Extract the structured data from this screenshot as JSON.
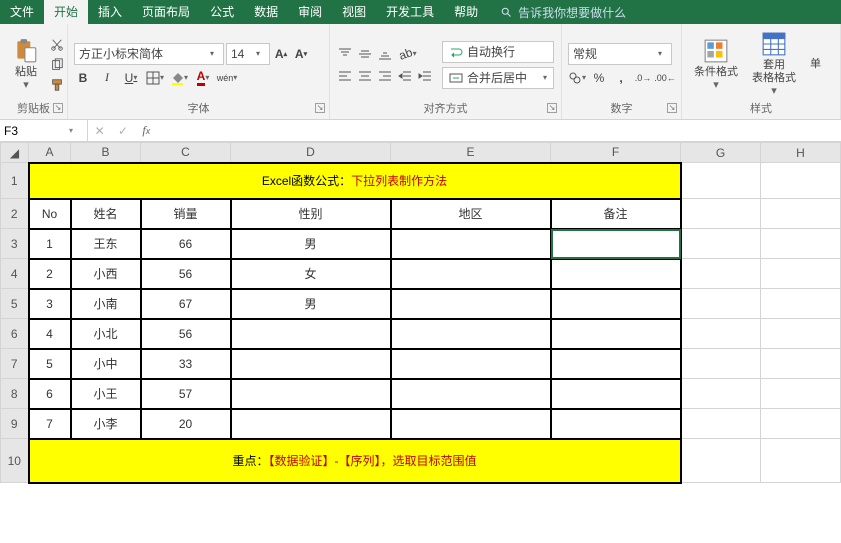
{
  "tabs": {
    "file": "文件",
    "home": "开始",
    "insert": "插入",
    "layout": "页面布局",
    "formulas": "公式",
    "data": "数据",
    "review": "审阅",
    "view": "视图",
    "dev": "开发工具",
    "help": "帮助",
    "tell": "告诉我你想要做什么"
  },
  "ribbon": {
    "clipboard": {
      "paste": "粘贴",
      "label": "剪贴板"
    },
    "font": {
      "name": "方正小标宋简体",
      "size": "14",
      "label": "字体"
    },
    "align": {
      "wrap": "自动换行",
      "merge": "合并后居中",
      "label": "对齐方式"
    },
    "number": {
      "format": "常规",
      "label": "数字"
    },
    "styles": {
      "cond": "条件格式",
      "table": "套用\n表格格式",
      "single": "单",
      "label": "样式"
    }
  },
  "namebox": "F3",
  "cols": [
    "A",
    "B",
    "C",
    "D",
    "E",
    "F",
    "G",
    "H"
  ],
  "rows": [
    "1",
    "2",
    "3",
    "4",
    "5",
    "6",
    "7",
    "8",
    "9",
    "10"
  ],
  "title": {
    "t1": "Excel函数公式：",
    "t2": "下拉列表制作方法"
  },
  "headers": {
    "a": "No",
    "b": "姓名",
    "c": "销量",
    "d": "性别",
    "e": "地区",
    "f": "备注"
  },
  "data": [
    {
      "no": "1",
      "name": "王东",
      "qty": "66",
      "sex": "男",
      "region": "",
      "note": ""
    },
    {
      "no": "2",
      "name": "小西",
      "qty": "56",
      "sex": "女",
      "region": "",
      "note": ""
    },
    {
      "no": "3",
      "name": "小南",
      "qty": "67",
      "sex": "男",
      "region": "",
      "note": ""
    },
    {
      "no": "4",
      "name": "小北",
      "qty": "56",
      "sex": "",
      "region": "",
      "note": ""
    },
    {
      "no": "5",
      "name": "小中",
      "qty": "33",
      "sex": "",
      "region": "",
      "note": ""
    },
    {
      "no": "6",
      "name": "小王",
      "qty": "57",
      "sex": "",
      "region": "",
      "note": ""
    },
    {
      "no": "7",
      "name": "小李",
      "qty": "20",
      "sex": "",
      "region": "",
      "note": ""
    }
  ],
  "footer": {
    "t1": "重点：",
    "t2": "【数据验证】-【序列】，选取目标范围值"
  }
}
